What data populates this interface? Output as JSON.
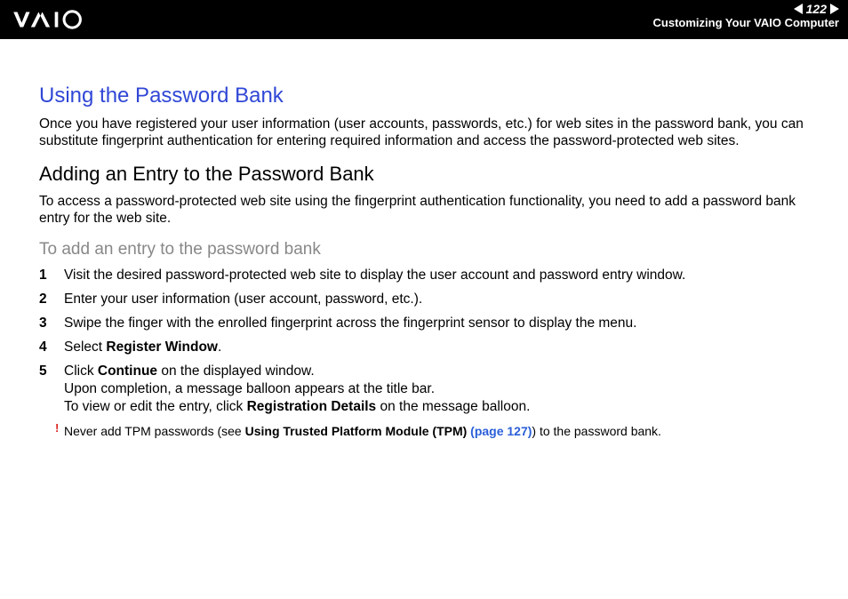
{
  "header": {
    "page_number": "122",
    "section_title": "Customizing Your VAIO Computer"
  },
  "content": {
    "h1": "Using the Password Bank",
    "p1": "Once you have registered your user information (user accounts, passwords, etc.) for web sites in the password bank, you can substitute fingerprint authentication for entering required information and access the password-protected web sites.",
    "h2": "Adding an Entry to the Password Bank",
    "p2": "To access a password-protected web site using the fingerprint authentication functionality, you need to add a password bank entry for the web site.",
    "h3": "To add an entry to the password bank",
    "steps": [
      {
        "text": "Visit the desired password-protected web site to display the user account and password entry window."
      },
      {
        "text": "Enter your user information (user account, password, etc.)."
      },
      {
        "text": "Swipe the finger with the enrolled fingerprint across the fingerprint sensor to display the menu."
      },
      {
        "pre": "Select ",
        "bold": "Register Window",
        "post": "."
      },
      {
        "pre": "Click ",
        "bold": "Continue",
        "post": " on the displayed window.",
        "line2": "Upon completion, a message balloon appears at the title bar.",
        "line3_pre": "To view or edit the entry, click ",
        "line3_bold": "Registration Details",
        "line3_post": " on the message balloon."
      }
    ],
    "note": {
      "bang": "!",
      "pre": "Never add TPM passwords (see ",
      "bold": "Using Trusted Platform Module (TPM) ",
      "link": "(page 127)",
      "post": ") to the password bank."
    }
  }
}
